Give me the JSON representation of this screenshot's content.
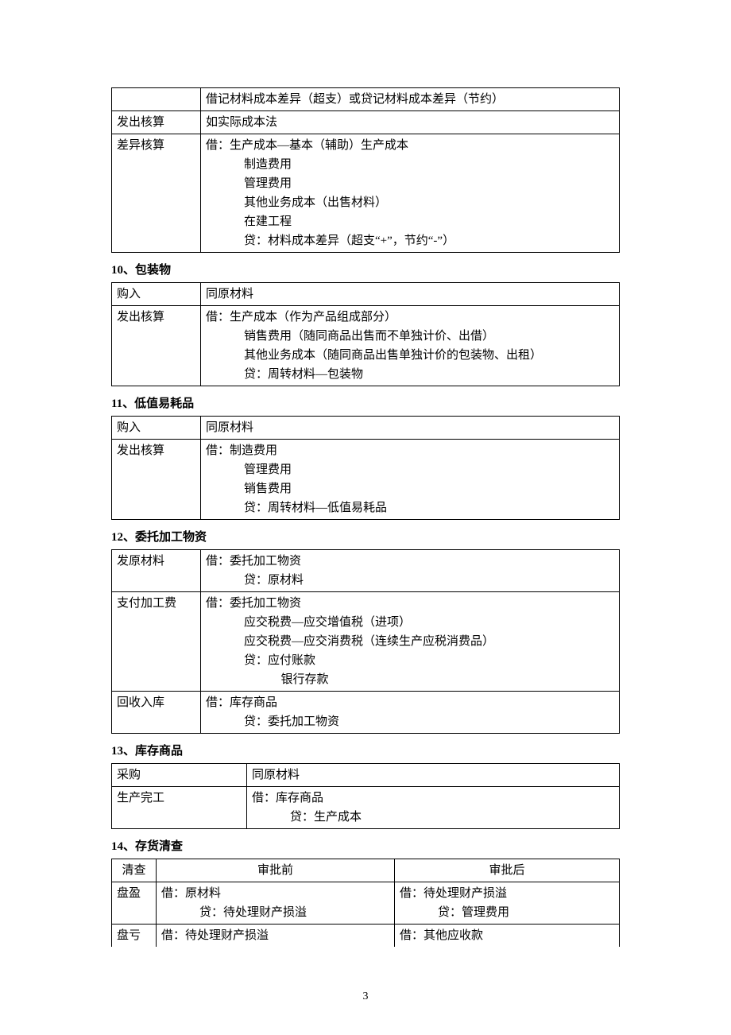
{
  "table1": {
    "r0": {
      "c0": "",
      "c1": "借记材料成本差异（超支）或贷记材料成本差异（节约）"
    },
    "r1": {
      "c0": "发出核算",
      "c1": "如实际成本法"
    },
    "r2": {
      "c0": "差异核算",
      "l0": "借：生产成本—基本（辅助）生产成本",
      "l1": "制造费用",
      "l2": "管理费用",
      "l3": "其他业务成本（出售材料）",
      "l4": "在建工程",
      "l5": "贷：材料成本差异（超支“+”，节约“-”）"
    }
  },
  "h10": "10、包装物",
  "table2": {
    "r0": {
      "c0": "购入",
      "c1": "同原材料"
    },
    "r1": {
      "c0": "发出核算",
      "l0": "借：生产成本（作为产品组成部分）",
      "l1": "销售费用（随同商品出售而不单独计价、出借）",
      "l2": "其他业务成本（随同商品出售单独计价的包装物、出租）",
      "l3": "贷：周转材料—包装物"
    }
  },
  "h11": "11、低值易耗品",
  "table3": {
    "r0": {
      "c0": "购入",
      "c1": "同原材料"
    },
    "r1": {
      "c0": "发出核算",
      "l0": "借：制造费用",
      "l1": "管理费用",
      "l2": "销售费用",
      "l3": "贷：周转材料—低值易耗品"
    }
  },
  "h12": "12、委托加工物资",
  "table4": {
    "r0": {
      "c0": "发原材料",
      "l0": "借：委托加工物资",
      "l1": "贷：原材料"
    },
    "r1": {
      "c0": "支付加工费",
      "l0": "借：委托加工物资",
      "l1": "应交税费—应交增值税（进项）",
      "l2": "应交税费—应交消费税（连续生产应税消费品）",
      "l3": "贷：应付账款",
      "l4": "银行存款"
    },
    "r2": {
      "c0": "回收入库",
      "l0": "借：库存商品",
      "l1": "贷：委托加工物资"
    }
  },
  "h13": "13、库存商品",
  "table5": {
    "r0": {
      "c0": "采购",
      "c1": "同原材料"
    },
    "r1": {
      "c0": "生产完工",
      "l0": "借：库存商品",
      "l1": "贷：生产成本"
    }
  },
  "h14": "14、存货清查",
  "table6": {
    "hdr": {
      "c0": "清查",
      "c1": "审批前",
      "c2": "审批后"
    },
    "r0": {
      "c0": "盘盈",
      "l10": "借：原材料",
      "l11": "贷：待处理财产损溢",
      "l20": "借：待处理财产损溢",
      "l21": "贷：管理费用"
    },
    "r1": {
      "c0": "盘亏",
      "l10": "借：待处理财产损溢",
      "l20": "借：其他应收款"
    }
  },
  "page_number": "3"
}
